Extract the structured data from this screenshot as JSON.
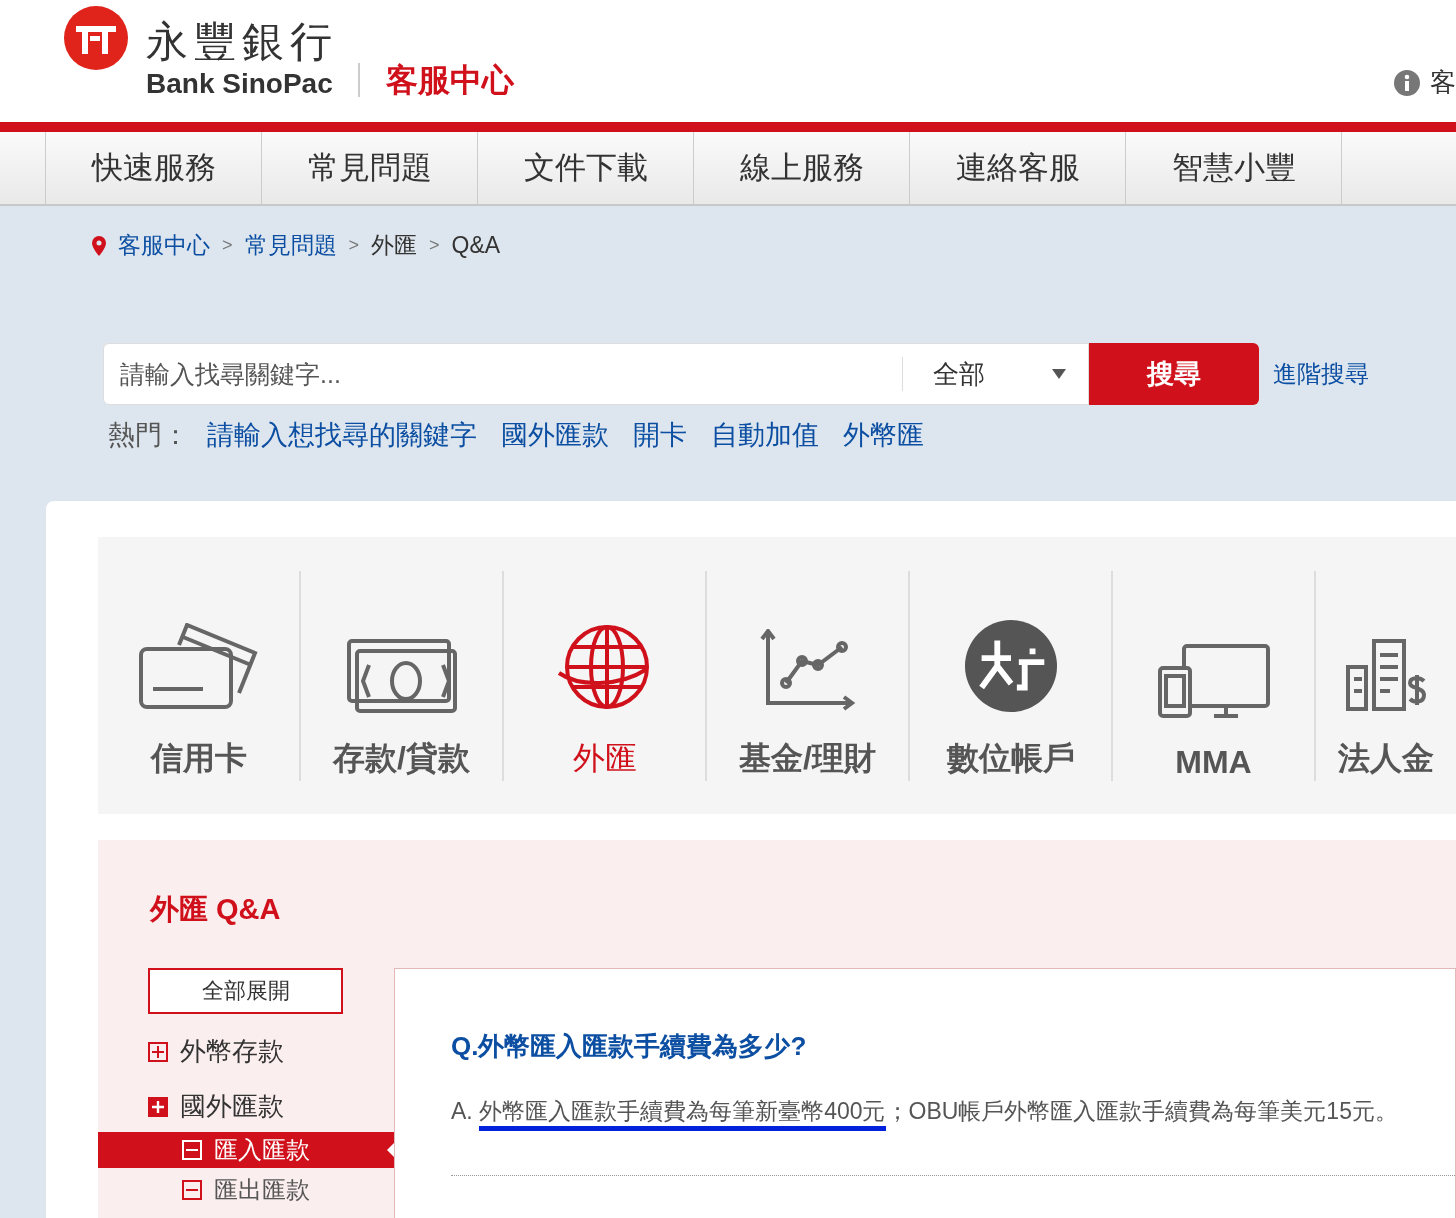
{
  "header": {
    "logo_chinese": "永豐銀行",
    "logo_english": "Bank SinoPac",
    "site_title": "客服中心",
    "top_link": "客"
  },
  "nav": [
    {
      "label": "快速服務"
    },
    {
      "label": "常見問題"
    },
    {
      "label": "文件下載"
    },
    {
      "label": "線上服務"
    },
    {
      "label": "連絡客服"
    },
    {
      "label": "智慧小豐"
    }
  ],
  "breadcrumb": [
    {
      "label": "客服中心",
      "link": true
    },
    {
      "separator": ">",
      "label": "常見問題",
      "link": true
    },
    {
      "separator": ">",
      "label": "外匯",
      "link": false
    },
    {
      "separator": ">",
      "label": "Q&A",
      "link": false
    }
  ],
  "search": {
    "placeholder": "請輸入找尋關鍵字...",
    "scope": "全部",
    "button": "搜尋",
    "advanced": "進階搜尋"
  },
  "hot": {
    "label": "熱門：",
    "keywords": [
      "請輸入想找尋的關鍵字",
      "國外匯款",
      "開卡",
      "自動加值",
      "外幣匯"
    ]
  },
  "categories": [
    {
      "label": "信用卡",
      "kind": "card",
      "selected": false
    },
    {
      "label": "存款/貸款",
      "kind": "cash",
      "selected": false
    },
    {
      "label": "外匯",
      "kind": "globe",
      "selected": true
    },
    {
      "label": "基金/理財",
      "kind": "chart",
      "selected": false
    },
    {
      "label": "數位帳戶",
      "kind": "digital",
      "selected": false
    },
    {
      "label": "MMA",
      "kind": "devices",
      "selected": false
    },
    {
      "label": "法人金",
      "kind": "corporate",
      "selected": false
    }
  ],
  "qa": {
    "title": "外匯 Q&A",
    "expand_all": "全部展開",
    "menu": [
      {
        "label": "外幣存款",
        "expanded": false
      },
      {
        "label": "國外匯款",
        "expanded": true,
        "children": [
          {
            "label": "匯入匯款",
            "selected": true
          },
          {
            "label": "匯出匯款",
            "selected": false
          }
        ]
      }
    ],
    "question": "Q.外幣匯入匯款手續費為多少?",
    "answer": [
      {
        "text": "A. ",
        "underlined": false
      },
      {
        "text": "外幣匯入匯款手續費為每筆新臺幣400元",
        "underlined": true
      },
      {
        "text": "；OBU帳戶外幣匯入匯款手續費為每筆美元15元。",
        "underlined": false
      }
    ]
  }
}
